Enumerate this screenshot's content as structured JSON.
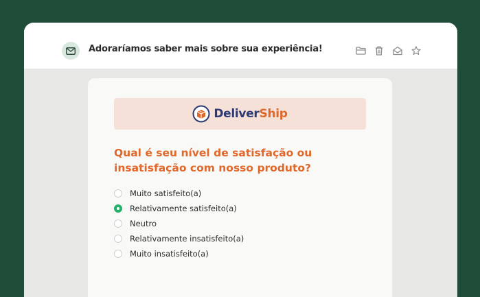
{
  "email": {
    "subject": "Adoraríamos saber mais sobre sua experiência!",
    "icons": [
      "mail-icon",
      "folder-icon",
      "trash-icon",
      "open-envelope-icon",
      "star-icon"
    ]
  },
  "brand": {
    "name_part1": "Deliver",
    "name_part2": "Ship",
    "primary_color": "#2b3a73",
    "accent_color": "#e0682b"
  },
  "survey": {
    "question": "Qual é seu nível de satisfação ou insatisfação com nosso produto?",
    "options": [
      {
        "label": "Muito satisfeito(a)",
        "selected": false
      },
      {
        "label": "Relativamente satisfeito(a)",
        "selected": true
      },
      {
        "label": "Neutro",
        "selected": false
      },
      {
        "label": "Relativamente insatisfeito(a)",
        "selected": false
      },
      {
        "label": "Muito insatisfeito(a)",
        "selected": false
      }
    ]
  },
  "colors": {
    "background": "#1f4d3a",
    "selected_radio": "#24b26b"
  }
}
